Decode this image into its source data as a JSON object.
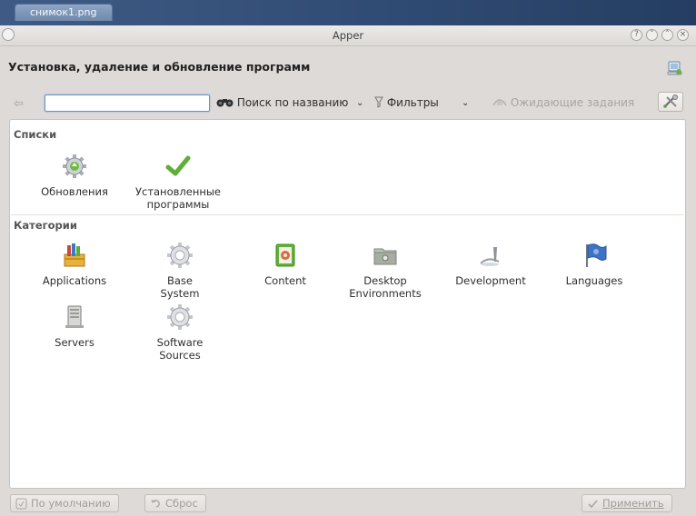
{
  "file_tab": {
    "name": "снимок1.png"
  },
  "window": {
    "title": "Apper",
    "help_btn": "?",
    "min_btn": "˅",
    "max_btn": "˄",
    "close_btn": "×"
  },
  "header": {
    "title": "Установка, удаление и обновление программ"
  },
  "toolbar": {
    "search_value": "",
    "search_by_name": "Поиск по названию",
    "dropdown_arrow": "⌄",
    "filters": "Фильтры",
    "pending": "Ожидающие задания"
  },
  "lists": {
    "heading": "Списки",
    "items": [
      {
        "label": "Обновления",
        "icon": "updates-gear-icon"
      },
      {
        "label": "Установленные\nпрограммы",
        "icon": "installed-check-icon"
      }
    ]
  },
  "categories": {
    "heading": "Категории",
    "items": [
      {
        "label": "Applications",
        "icon": "applications-icon"
      },
      {
        "label": "Base\nSystem",
        "icon": "base-system-gear-icon"
      },
      {
        "label": "Content",
        "icon": "content-icon"
      },
      {
        "label": "Desktop\nEnvironments",
        "icon": "desktop-environments-icon"
      },
      {
        "label": "Development",
        "icon": "development-icon"
      },
      {
        "label": "Languages",
        "icon": "languages-flag-icon"
      },
      {
        "label": "Servers",
        "icon": "servers-icon"
      },
      {
        "label": "Software\nSources",
        "icon": "software-sources-gear-icon"
      }
    ]
  },
  "bottom": {
    "defaults": "По умолчанию",
    "reset": "Сброс",
    "apply": "Применить"
  }
}
